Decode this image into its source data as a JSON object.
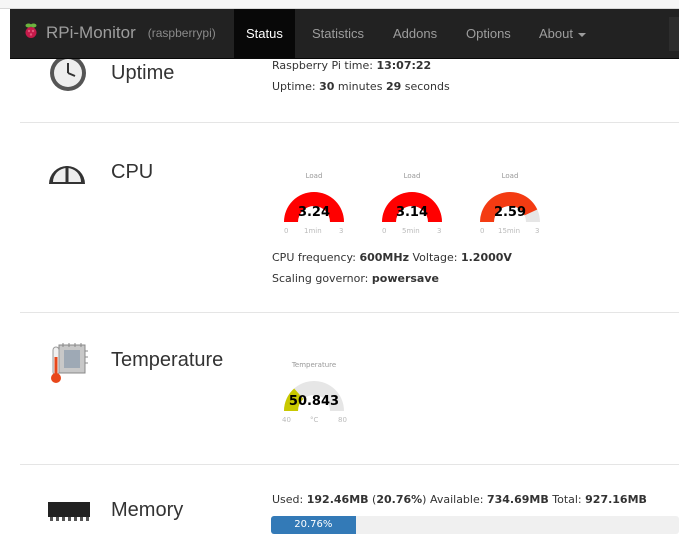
{
  "navbar": {
    "brand": "RPi-Monitor",
    "host": "(raspberrypi)",
    "items": [
      "Status",
      "Statistics",
      "Addons",
      "Options",
      "About"
    ]
  },
  "uptime": {
    "title": "Uptime",
    "time_label": "Raspberry Pi time:",
    "time_value": "13:07:22",
    "uptime_label": "Uptime:",
    "minutes": "30",
    "minutes_unit": "minutes",
    "seconds": "29",
    "seconds_unit": "seconds"
  },
  "cpu": {
    "title": "CPU",
    "gauges": [
      {
        "label": "Load",
        "value": "3.24",
        "min": "0",
        "max": "3",
        "unit": "1min",
        "level": 1.0,
        "color": "#ff0000"
      },
      {
        "label": "Load",
        "value": "3.14",
        "min": "0",
        "max": "3",
        "unit": "5min",
        "level": 1.0,
        "color": "#ff0000"
      },
      {
        "label": "Load",
        "value": "2.59",
        "min": "0",
        "max": "3",
        "unit": "15min",
        "level": 0.863,
        "color": "#f43b12"
      }
    ],
    "freq_label": "CPU frequency:",
    "freq_value": "600MHz",
    "voltage_label": "Voltage:",
    "voltage_value": "1.2000V",
    "governor_label": "Scaling governor:",
    "governor_value": "powersave"
  },
  "temperature": {
    "title": "Temperature",
    "gauge": {
      "label": "Temperature",
      "value": "50.843",
      "min": "40",
      "max": "80",
      "unit": "°C",
      "level": 0.27,
      "color": "#c8c800"
    }
  },
  "memory": {
    "title": "Memory",
    "used_label": "Used:",
    "used_value": "192.46MB",
    "used_percent": "20.76%",
    "available_label": "Available:",
    "available_value": "734.69MB",
    "total_label": "Total:",
    "total_value": "927.16MB",
    "bar_text": "20.76%",
    "bar_fraction": 0.2076
  }
}
